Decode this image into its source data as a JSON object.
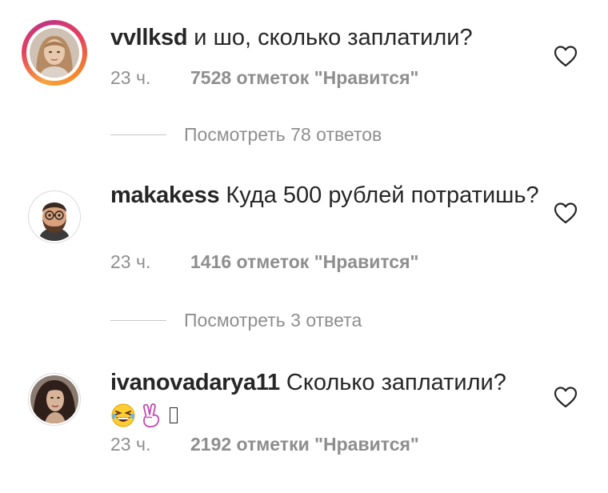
{
  "comments": [
    {
      "username": "vvllksd",
      "text": " и шо, сколько заплатили?",
      "time": "23 ч.",
      "likes": "7528 отметок \"Нравится\"",
      "replies": "Посмотреть 78 ответов"
    },
    {
      "username": "makakess",
      "text": " Куда 500 рублей потратишь?",
      "time": "23 ч.",
      "likes": "1416 отметок \"Нравится\"",
      "replies": "Посмотреть 3 ответа"
    },
    {
      "username": "ivanovadarya11",
      "text": " Сколько заплатили?",
      "time": "23 ч.",
      "likes": "2192 отметки \"Нравится\""
    }
  ],
  "icons": {
    "like": "heart-outline-icon",
    "emoji_1": "grinning-squinting-face-emoji",
    "emoji_2": "victory-hand-emoji"
  },
  "colors": {
    "text": "#262626",
    "secondary": "#8e8e8e",
    "story_ring": "#e4405f"
  }
}
